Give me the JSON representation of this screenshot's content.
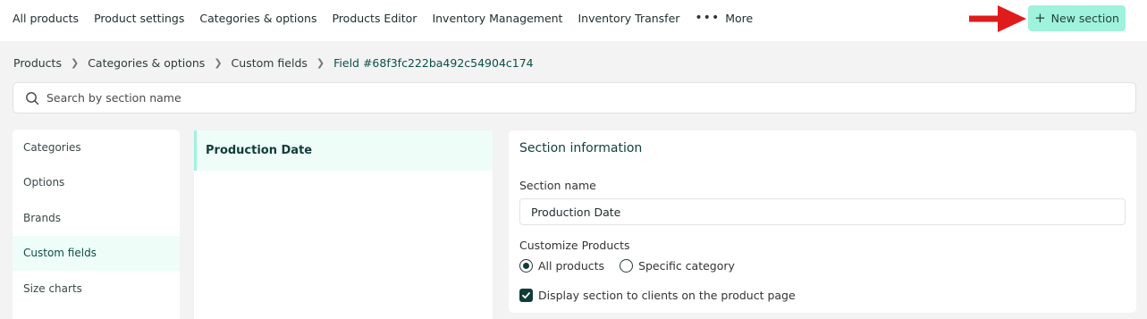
{
  "topnav": {
    "items": [
      "All products",
      "Product settings",
      "Categories & options",
      "Products Editor",
      "Inventory Management",
      "Inventory Transfer"
    ],
    "more_label": "More"
  },
  "new_section_button": {
    "label": "New section"
  },
  "breadcrumb": {
    "items": [
      "Products",
      "Categories & options",
      "Custom fields"
    ],
    "current": "Field #68f3fc222ba492c54904c174"
  },
  "search": {
    "placeholder": "Search by section name",
    "value": ""
  },
  "sidebar": {
    "items": [
      {
        "label": "Categories",
        "active": false
      },
      {
        "label": "Options",
        "active": false
      },
      {
        "label": "Brands",
        "active": false
      },
      {
        "label": "Custom fields",
        "active": true
      },
      {
        "label": "Size charts",
        "active": false
      }
    ]
  },
  "sections_list": {
    "selected": "Production Date"
  },
  "section_info": {
    "title": "Section information",
    "name_label": "Section name",
    "name_value": "Production Date",
    "customize_label": "Customize Products",
    "radio_all": "All products",
    "radio_specific": "Specific category",
    "selected_radio": "All products",
    "checkbox_label": "Display section to clients on the product page",
    "checkbox_checked": true
  },
  "colors": {
    "accent": "#9ff2dc",
    "active_bg": "#effdf8",
    "dark_teal": "#123c3a",
    "arrow_red": "#e01b1b"
  }
}
